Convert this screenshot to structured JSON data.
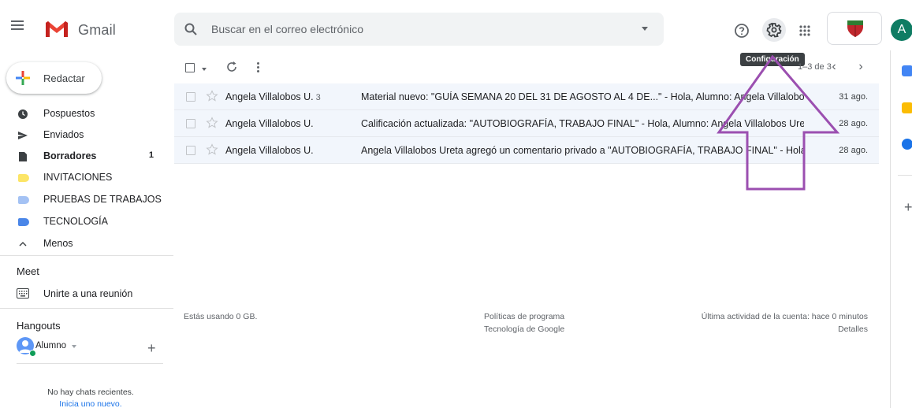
{
  "header": {
    "app_name": "Gmail",
    "search_placeholder": "Buscar en el correo electrónico",
    "avatar_letter": "A"
  },
  "tooltip": "Configuración",
  "sidebar": {
    "compose_label": "Redactar",
    "items": [
      {
        "label": "Pospuestos",
        "count": ""
      },
      {
        "label": "Enviados",
        "count": ""
      },
      {
        "label": "Borradores",
        "count": "1"
      },
      {
        "label": "INVITACIONES",
        "count": ""
      },
      {
        "label": "PRUEBAS DE TRABAJOS",
        "count": ""
      },
      {
        "label": "TECNOLOGÍA",
        "count": ""
      },
      {
        "label": "Menos",
        "count": ""
      }
    ],
    "label_colors": {
      "invitaciones": "#fce566",
      "pruebas": "#a4c2f4",
      "tecnologia": "#4a86e8"
    },
    "meet": {
      "title": "Meet",
      "join_label": "Unirte a una reunión"
    },
    "hangouts": {
      "title": "Hangouts",
      "user_name": "Alumno",
      "no_chats": "No hay chats recientes.",
      "start_new": "Inicia uno nuevo."
    }
  },
  "toolbar": {
    "pager_text": "1–3 de 3"
  },
  "mails": [
    {
      "sender": "Angela Villalobos U.",
      "thread_count": "3",
      "subject": "Material nuevo: \"GUÍA SEMANA 20 DEL 31 DE AGOSTO AL 4 DE...\" - Hola, Alumno: Angela Villalobos ...",
      "date": "31 ago."
    },
    {
      "sender": "Angela Villalobos U.",
      "thread_count": "",
      "subject": "Calificación actualizada: \"AUTOBIOGRAFÍA, TRABAJO FINAL\" - Hola, Alumno: Angela Villalobos Ureta...",
      "date": "28 ago."
    },
    {
      "sender": "Angela Villalobos U.",
      "thread_count": "",
      "subject": "Angela Villalobos Ureta agregó un comentario privado a \"AUTOBIOGRAFÍA, TRABAJO FINAL\" - Hola, ...",
      "date": "28 ago."
    }
  ],
  "footer": {
    "storage": "Estás usando 0 GB.",
    "policies": "Políticas de programa",
    "powered_by": "Tecnología de Google",
    "last_activity": "Última actividad de la cuenta: hace 0 minutos",
    "details": "Detalles"
  },
  "colors": {
    "accent": "#1a73e8",
    "row_bg": "#f2f6fc",
    "annotation_arrow": "#9b4fb0"
  }
}
